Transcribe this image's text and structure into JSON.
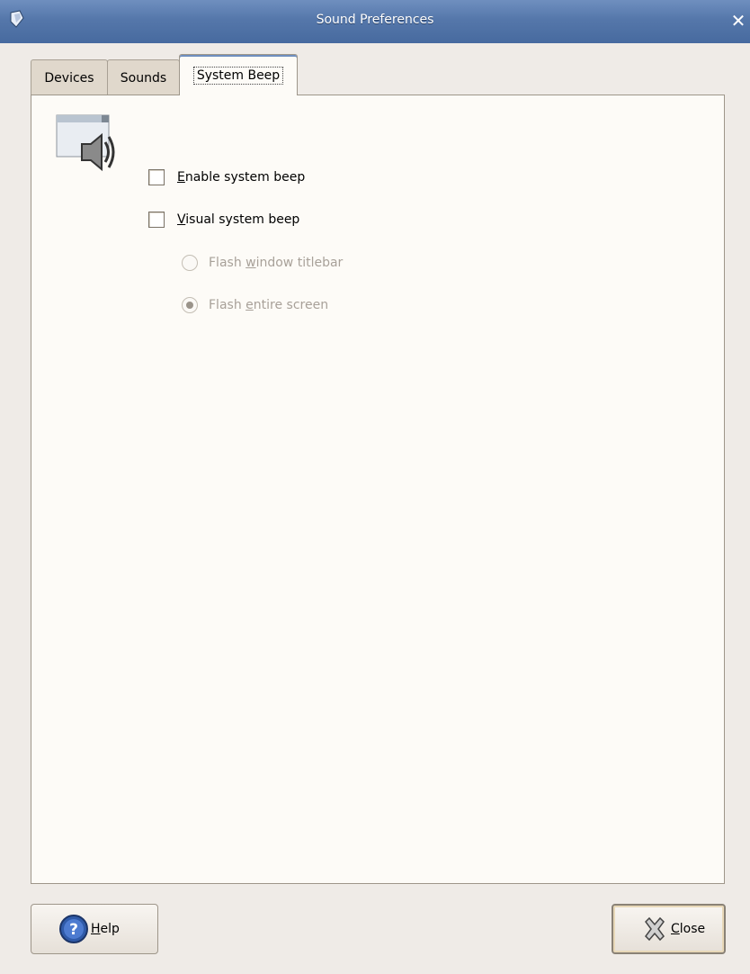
{
  "window": {
    "title": "Sound Preferences",
    "close_glyph": "✕",
    "menu_icon": "window-menu-icon"
  },
  "tabs": [
    {
      "label": "Devices",
      "active": false
    },
    {
      "label": "Sounds",
      "active": false
    },
    {
      "label": "System Beep",
      "active": true
    }
  ],
  "system_beep": {
    "icon": "speaker-icon",
    "enable": {
      "mnemonic": "E",
      "rest": "nable system beep",
      "checked": false
    },
    "visual": {
      "mnemonic": "V",
      "rest": "isual system beep",
      "checked": false
    },
    "flash_titlebar": {
      "before": "Flash ",
      "mnemonic": "w",
      "after": "indow titlebar",
      "selected": false,
      "enabled": false
    },
    "flash_screen": {
      "before": "Flash ",
      "mnemonic": "e",
      "after": "ntire screen",
      "selected": true,
      "enabled": false
    }
  },
  "buttons": {
    "help": {
      "mnemonic": "H",
      "rest": "elp",
      "icon": "help-icon"
    },
    "close": {
      "mnemonic": "C",
      "rest": "lose",
      "icon": "close-icon"
    }
  },
  "colors": {
    "titlebar": "#5577aa",
    "background": "#efebe7",
    "panel": "#fdfbf7",
    "disabled_text": "#a8a199"
  }
}
